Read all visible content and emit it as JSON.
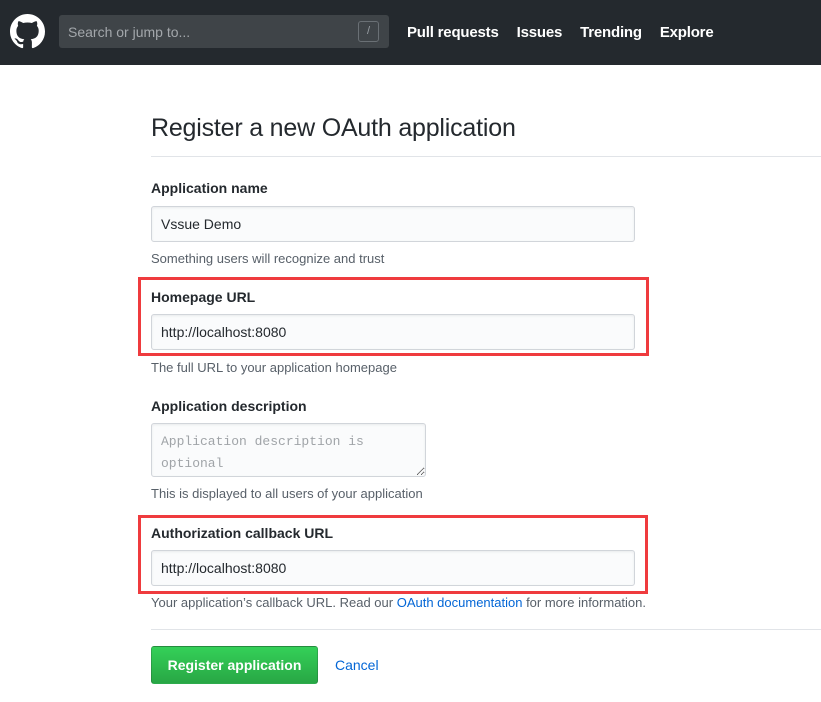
{
  "header": {
    "logo": "github-octocat-icon",
    "search": {
      "placeholder": "Search or jump to...",
      "value": "",
      "shortcut_key": "/"
    },
    "nav": [
      {
        "label": "Pull requests"
      },
      {
        "label": "Issues"
      },
      {
        "label": "Trending"
      },
      {
        "label": "Explore"
      }
    ]
  },
  "form": {
    "title": "Register a new OAuth application",
    "application_name": {
      "label": "Application name",
      "value": "Vssue Demo",
      "note": "Something users will recognize and trust"
    },
    "homepage_url": {
      "label": "Homepage URL",
      "value": "http://localhost:8080",
      "note": "The full URL to your application homepage",
      "highlighted": true
    },
    "application_description": {
      "label": "Application description",
      "value": "",
      "placeholder": "Application description is optional",
      "note": "This is displayed to all users of your application"
    },
    "callback_url": {
      "label": "Authorization callback URL",
      "value": "http://localhost:8080",
      "note_prefix": "Your application’s callback URL. Read our ",
      "note_link": "OAuth documentation",
      "note_suffix": " for more information.",
      "highlighted": true
    },
    "actions": {
      "submit_label": "Register application",
      "cancel_label": "Cancel"
    }
  },
  "colors": {
    "header_bg": "#24292e",
    "primary_button": "#28a745",
    "link": "#0366d6",
    "highlight_box": "#ef3b3e"
  }
}
